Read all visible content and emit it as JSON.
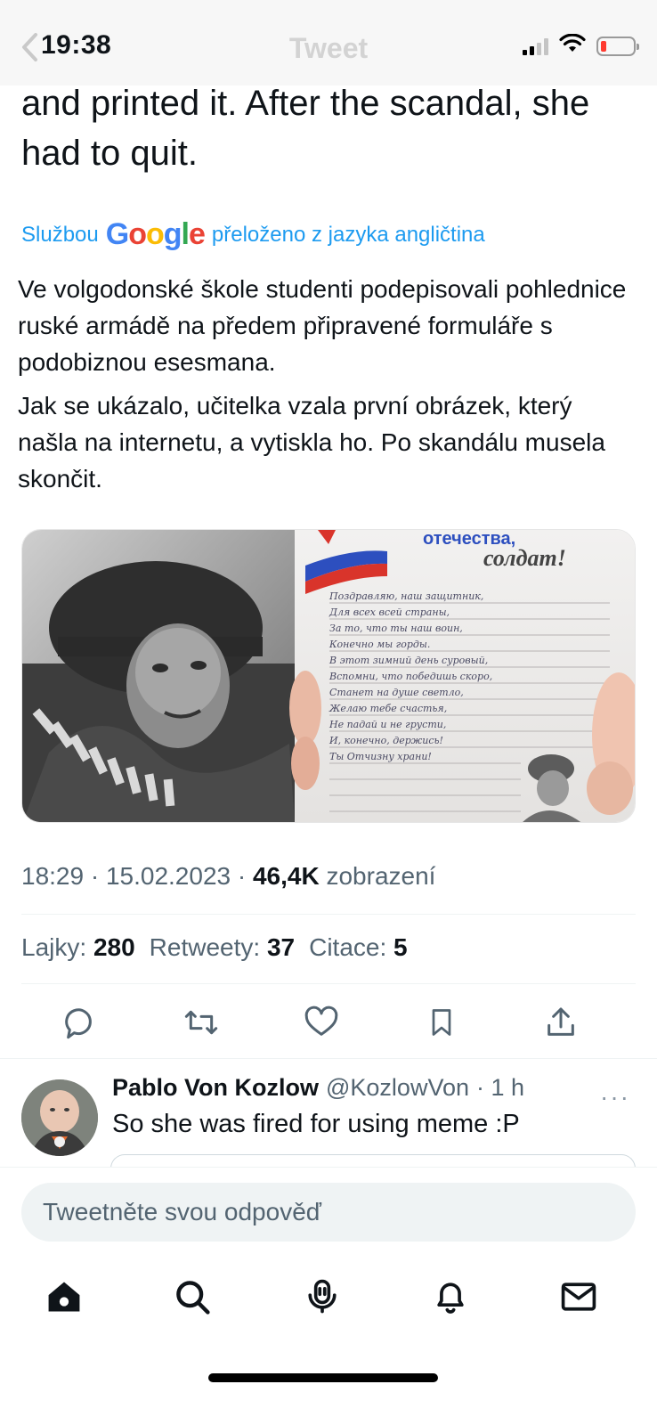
{
  "status_bar": {
    "time": "19:38",
    "nav_title": "Tweet"
  },
  "tweet": {
    "original_text": "and printed it. After the scandal, she had to quit.",
    "translation_prefix": "Službou",
    "translation_brand": "Google",
    "translation_suffix": "přeloženo z jazyka angličtina",
    "translated_paragraphs": [
      "Ve volgodonské škole studenti podepisovali pohlednice ruské armádě na předem připravené formuláře s podobiznou esesmana.",
      "Jak se ukázalo, učitelka vzala první obrázek, který našla na internetu, a vytiskla ho. Po skandálu musela skončit."
    ],
    "media": {
      "card_heading": "отечества,",
      "card_word": "солдат!",
      "handwritten_lines": [
        "Поздравляю, наш защитник,",
        "Для всех всей страны,",
        "За то, что ты наш воин,",
        "Конечно мы горды.",
        "В этот зимний день суровый,",
        "Вспомни, что победишь скоро,",
        "Станет на душе светло,",
        "Желаю тебе счастья,",
        "Не падай и не грусти,",
        "И, конечно, держись!",
        "Ты Отчизну храни!"
      ]
    },
    "timestamp": "18:29 · 15.02.2023 ·",
    "views_count": "46,4K",
    "views_label": "zobrazení",
    "stats": {
      "likes_label": "Lajky:",
      "likes": "280",
      "retweets_label": "Retweety:",
      "retweets": "37",
      "quotes_label": "Citace:",
      "quotes": "5"
    }
  },
  "reply": {
    "name": "Pablo Von Kozlow",
    "handle": "@KozlowVon",
    "time": "· 1 h",
    "more": "···",
    "text": "So she was fired for using meme :P"
  },
  "compose": {
    "placeholder": "Tweetněte svou odpověď"
  },
  "colors": {
    "accent": "#1d9bf0",
    "text": "#0f1419",
    "secondary": "#536471",
    "battery_low": "#ff3b30"
  },
  "icons": {
    "actions": [
      "reply-icon",
      "retweet-icon",
      "like-icon",
      "bookmark-icon",
      "share-icon"
    ],
    "tabs": [
      "home-icon",
      "search-icon",
      "spaces-icon",
      "notifications-icon",
      "messages-icon"
    ]
  }
}
